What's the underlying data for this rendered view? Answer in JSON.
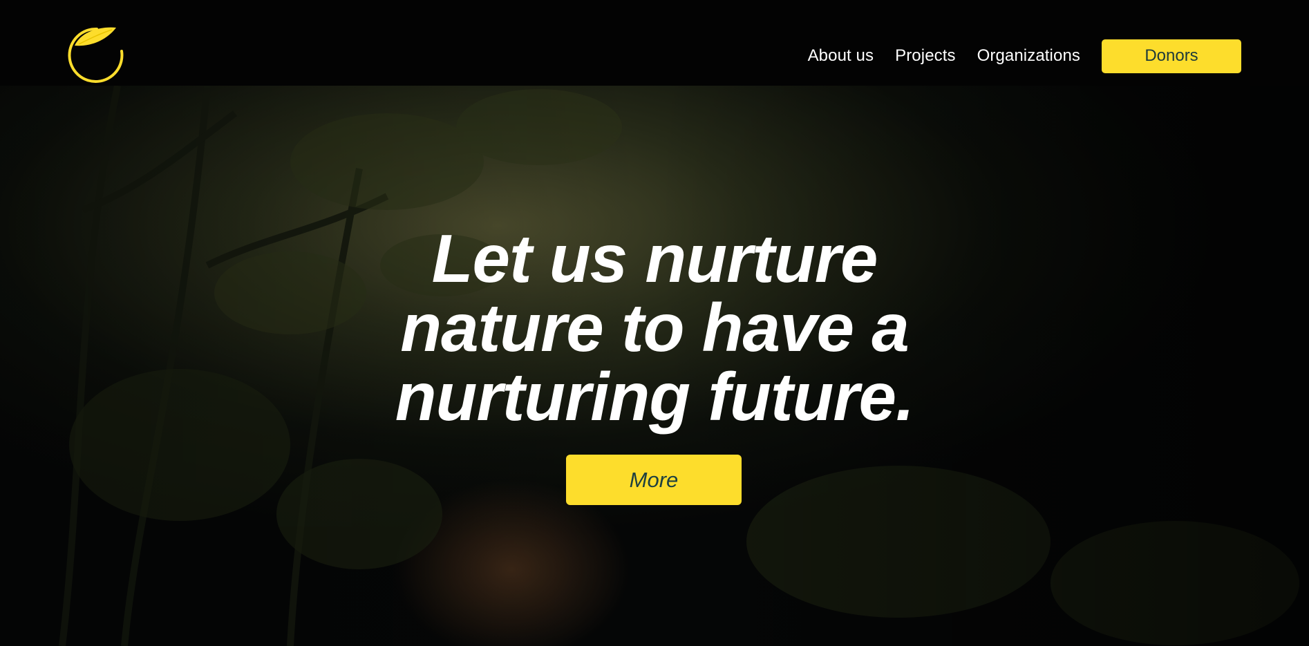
{
  "header": {
    "logo_icon": "leaf-circle-logo-icon",
    "nav_links": [
      {
        "label": "About us"
      },
      {
        "label": "Projects"
      },
      {
        "label": "Organizations"
      }
    ],
    "donors_label": "Donors"
  },
  "hero": {
    "background_icon": "forest-path-photo",
    "headline_lines": [
      "Let us nurture",
      "nature to have a",
      "nurturing future."
    ],
    "more_label": "More"
  },
  "colors": {
    "accent": "#fddd2c",
    "button_text": "#1e4040",
    "header_bg": "#030303",
    "headline": "#ffffff"
  }
}
